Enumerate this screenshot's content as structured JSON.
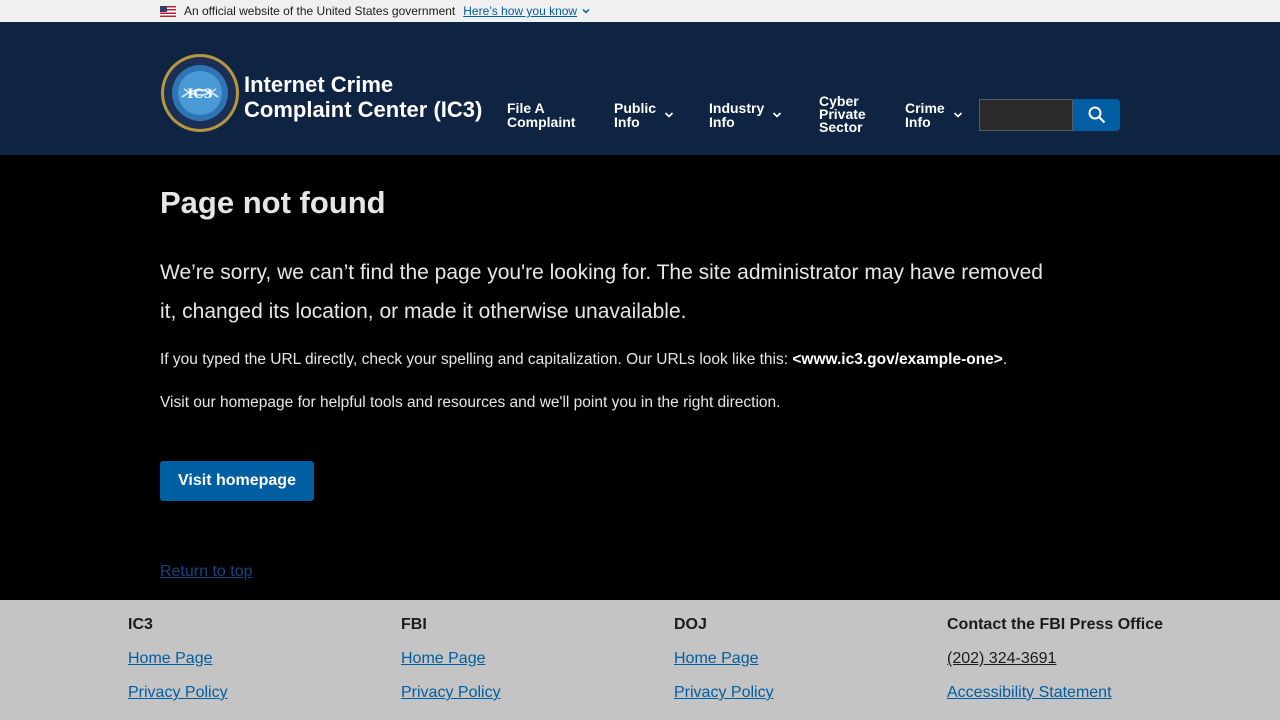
{
  "banner": {
    "official_text": "An official website of the United States government",
    "how_link": "Here’s how you know"
  },
  "header": {
    "title_line1": "Internet Crime",
    "title_line2": "Complaint Center (IC3)",
    "nav": [
      {
        "line1": "File A",
        "line2": "Complaint",
        "line3": ""
      },
      {
        "line1": "Public",
        "line2": "Info",
        "line3": ""
      },
      {
        "line1": "Industry",
        "line2": "Info",
        "line3": ""
      },
      {
        "line1": "Cyber",
        "line2": "Private",
        "line3": "Sector"
      },
      {
        "line1": "Crime",
        "line2": "Info",
        "line3": ""
      }
    ],
    "search_placeholder": ""
  },
  "main": {
    "title": "Page not found",
    "lead": "We’re sorry, we can’t find the page you're looking for. The site administrator may have removed it, changed its location, or made it otherwise unavailable.",
    "url_hint_prefix": "If you typed the URL directly, check your spelling and capitalization. Our URLs look like this: ",
    "url_example": "<www.ic3.gov/example-one>",
    "url_hint_suffix": ".",
    "homepage_hint": "Visit our homepage for helpful tools and resources and we'll point you in the right direction.",
    "button_label": "Visit homepage",
    "return_top": "Return to top"
  },
  "footer": {
    "columns": [
      {
        "heading": "IC3",
        "link1": "Home Page",
        "link2": "Privacy Policy"
      },
      {
        "heading": "FBI",
        "link1": "Home Page",
        "link2": "Privacy Policy"
      },
      {
        "heading": "DOJ",
        "link1": "Home Page",
        "link2": "Privacy Policy"
      },
      {
        "heading": "Contact the FBI Press Office",
        "link1": "(202) 324-3691",
        "link2": "Accessibility Statement"
      }
    ]
  },
  "colors": {
    "header_bg": "#0f2442",
    "accent": "#005ea2",
    "footer_bg": "#c4c4c4"
  }
}
